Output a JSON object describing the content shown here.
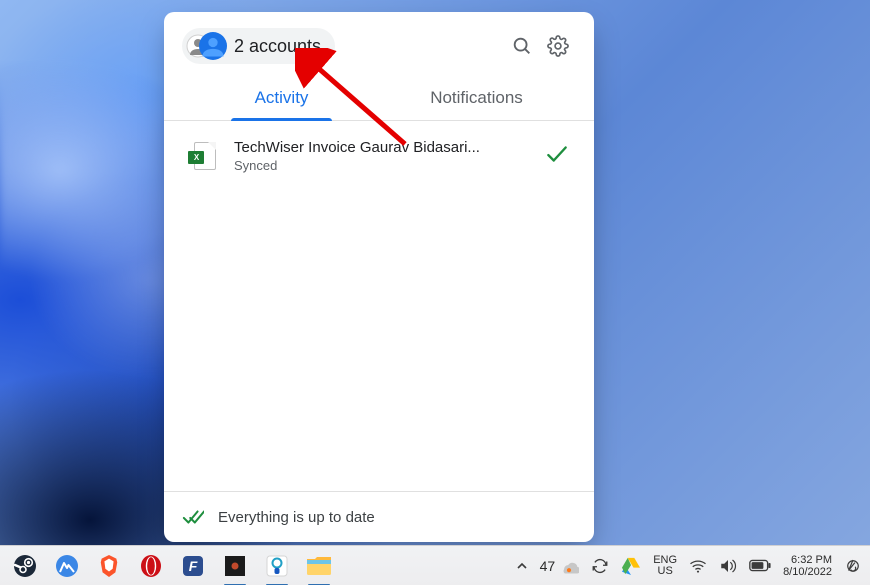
{
  "drive_popup": {
    "accounts_label": "2 accounts",
    "tabs": {
      "activity": "Activity",
      "notifications": "Notifications"
    },
    "active_tab": "activity",
    "files": [
      {
        "name": "TechWiser Invoice Gaurav Bidasari...",
        "status": "Synced",
        "app": "excel",
        "checked": true
      }
    ],
    "footer_status": "Everything is up to date"
  },
  "taskbar": {
    "temperature": "47",
    "language": {
      "lang": "ENG",
      "region": "US"
    },
    "time": "6:32 PM",
    "date": "8/10/2022"
  }
}
